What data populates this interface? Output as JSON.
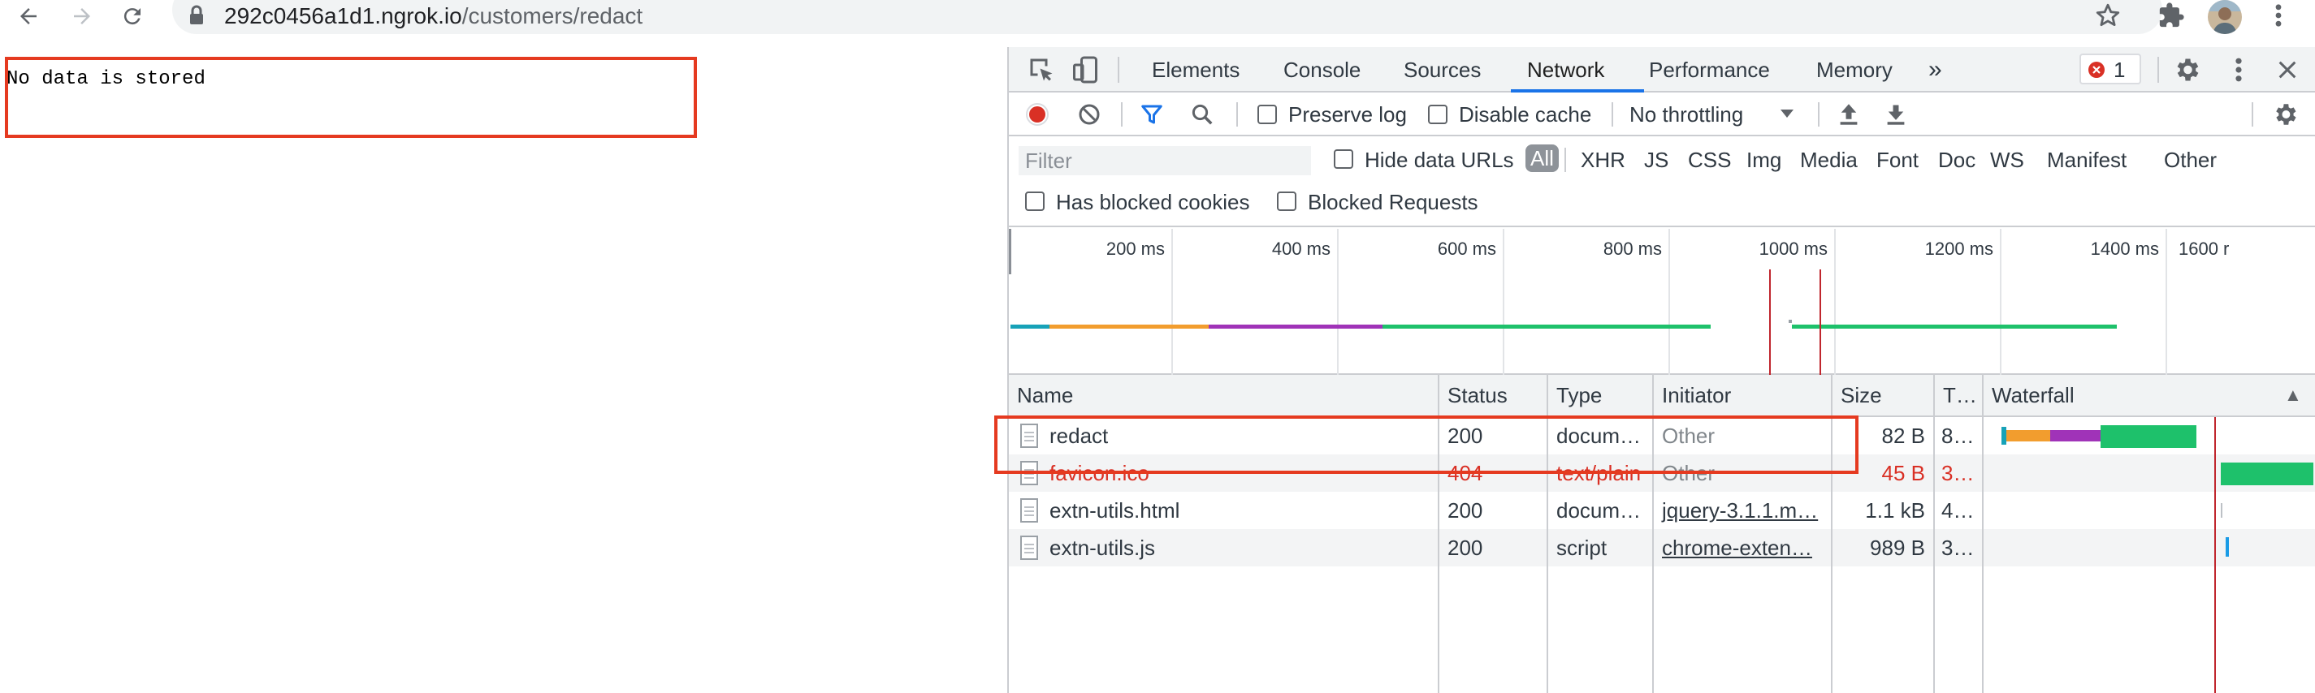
{
  "browser": {
    "url_host": "292c0456a1d1.ngrok.io",
    "url_path": "/customers/redact",
    "icons": [
      "back-arrow-icon",
      "forward-arrow-icon",
      "reload-icon",
      "lock-icon",
      "star-icon",
      "extensions-puzzle-icon",
      "profile-avatar",
      "kebab-menu-icon"
    ]
  },
  "page": {
    "text": "No data is stored",
    "highlight_color": "#e53a20"
  },
  "devtools": {
    "tabs": [
      "Elements",
      "Console",
      "Sources",
      "Network",
      "Performance",
      "Memory"
    ],
    "active_tab": "Network",
    "more_tabs_glyph": "»",
    "error_count": "1",
    "toolbar": {
      "preserve_log": "Preserve log",
      "disable_cache": "Disable cache",
      "throttling": "No throttling"
    },
    "filter": {
      "placeholder": "Filter",
      "hide_data_urls": "Hide data URLs",
      "types": [
        "All",
        "XHR",
        "JS",
        "CSS",
        "Img",
        "Media",
        "Font",
        "Doc",
        "WS",
        "Manifest",
        "Other"
      ],
      "has_blocked_cookies": "Has blocked cookies",
      "blocked_requests": "Blocked Requests"
    },
    "overview": {
      "ticks": [
        "200 ms",
        "400 ms",
        "600 ms",
        "800 ms",
        "1000 ms",
        "1200 ms",
        "1400 ms",
        "1600 r"
      ]
    },
    "table": {
      "columns": [
        "Name",
        "Status",
        "Type",
        "Initiator",
        "Size",
        "T…",
        "Waterfall"
      ],
      "sort_glyph": "▲",
      "rows": [
        {
          "name": "redact",
          "status": "200",
          "type": "docum…",
          "initiator": "Other",
          "size": "82 B",
          "time": "8…"
        },
        {
          "name": "favicon.ico",
          "status": "404",
          "type": "text/plain",
          "initiator": "Other",
          "size": "45 B",
          "time": "3…"
        },
        {
          "name": "extn-utils.html",
          "status": "200",
          "type": "docum…",
          "initiator": "jquery-3.1.1.m…",
          "size": "1.1 kB",
          "time": "4…"
        },
        {
          "name": "extn-utils.js",
          "status": "200",
          "type": "script",
          "initiator": "chrome-exten…",
          "size": "989 B",
          "time": "3…"
        }
      ]
    },
    "colors": {
      "record": "#d93025",
      "accent": "#1a73e8",
      "timing_queue": "#17a2b8",
      "timing_waiting": "#f29d2e",
      "timing_ssl": "#a033b8",
      "timing_download": "#1ec16b",
      "dom_loaded": "#1a73e8",
      "load": "#c0262d"
    }
  }
}
